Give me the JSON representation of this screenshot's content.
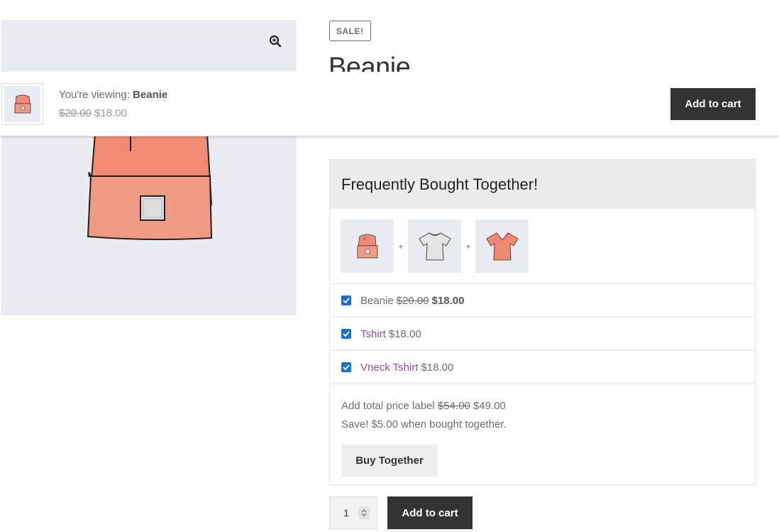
{
  "product": {
    "badge": "SALE!",
    "title": "Beanie"
  },
  "sticky_bar": {
    "viewing_prefix": "You're viewing:",
    "viewing_name": "Beanie",
    "old_price": "$20.00",
    "price": "$18.00",
    "add_to_cart": "Add to cart"
  },
  "fbt": {
    "heading": "Frequently Bought Together!",
    "plus": "+",
    "items": [
      {
        "name": "Beanie",
        "old_price": "$20.00",
        "price": "$18.00",
        "checked": true
      },
      {
        "name": "Tshirt",
        "price": "$18.00",
        "checked": true
      },
      {
        "name": "Vneck Tshirt",
        "price": "$18.00",
        "checked": true
      }
    ],
    "total_label": "Add total price label",
    "total_old": "$54.00",
    "total_new": "$49.00",
    "save_text": "Save! $5.00 when bought together.",
    "buy_button": "Buy Together"
  },
  "cart": {
    "quantity": "1",
    "add_to_cart": "Add to cart"
  },
  "colors": {
    "accent_link": "#7f54b3",
    "checkbox": "#1a6ed8",
    "button_dark": "#333333",
    "image_bg": "#e9edf1",
    "beanie": "#f08a73"
  }
}
